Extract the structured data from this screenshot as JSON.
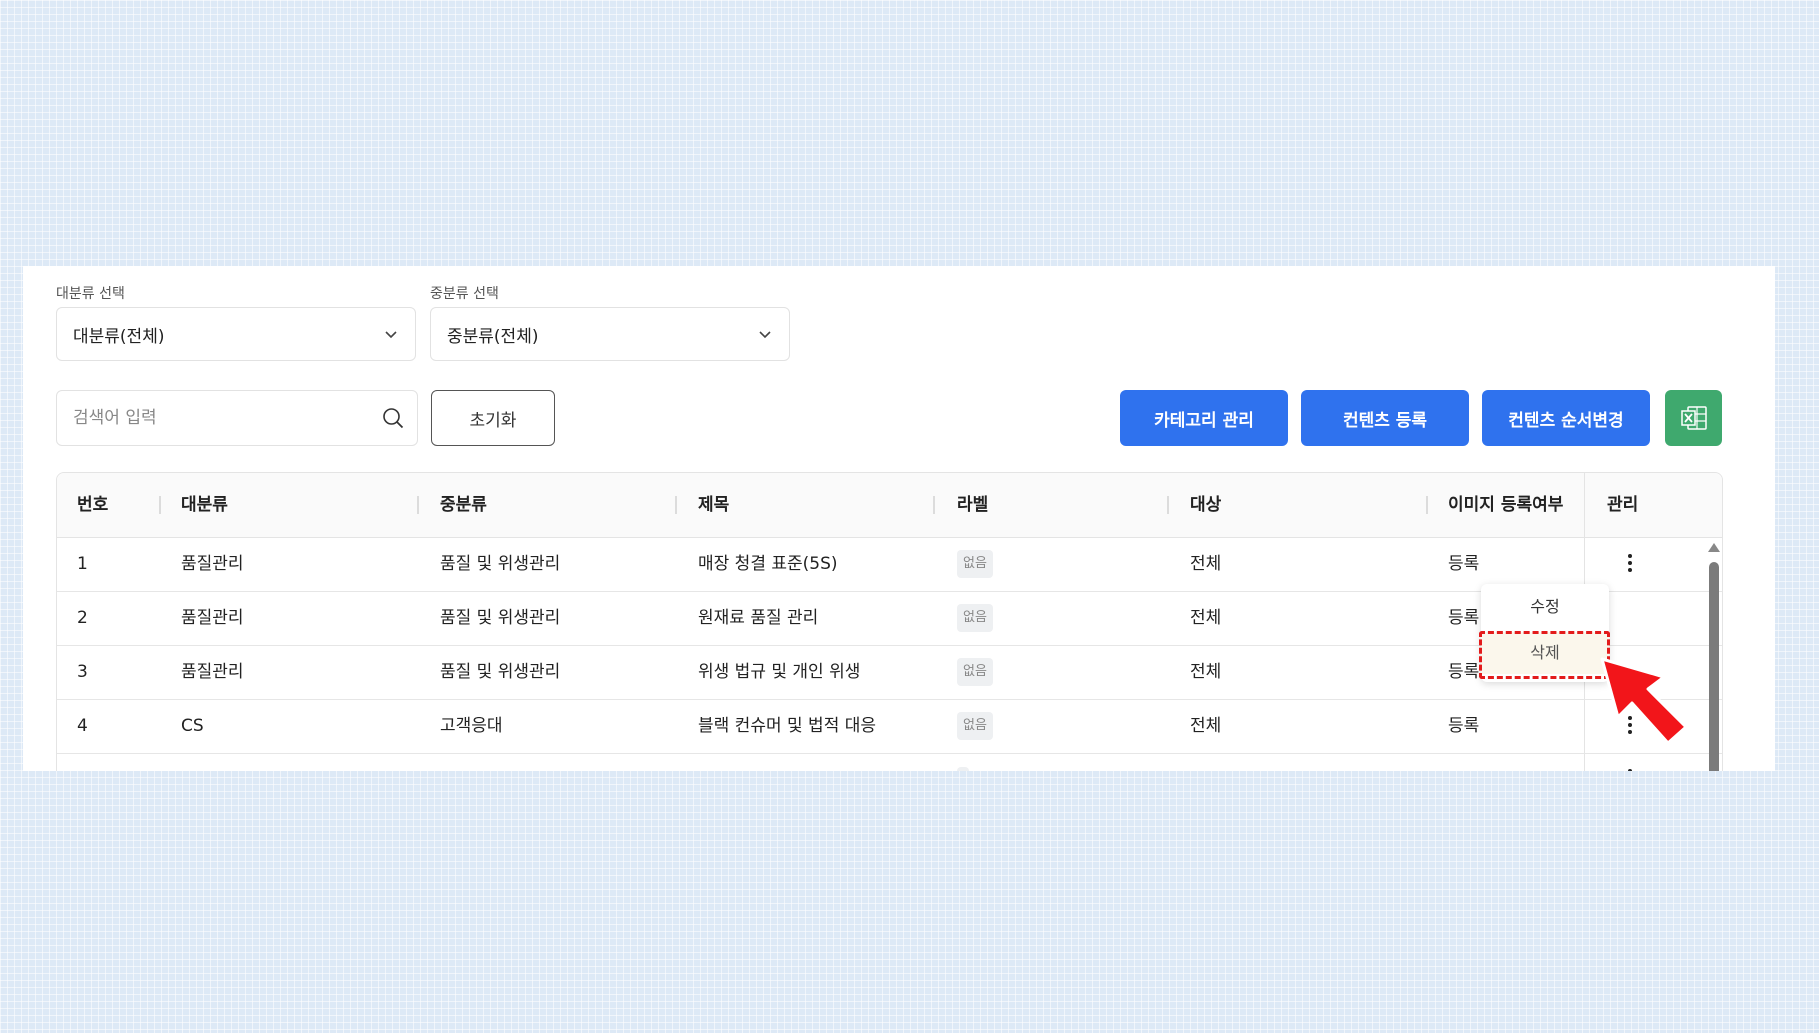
{
  "filters": {
    "major": {
      "label": "대분류 선택",
      "value": "대분류(전체)"
    },
    "middle": {
      "label": "중분류 선택",
      "value": "중분류(전체)"
    }
  },
  "search": {
    "placeholder": "검색어 입력"
  },
  "buttons": {
    "reset": "초기화",
    "category": "카테고리 관리",
    "register": "컨텐츠 등록",
    "reorder": "컨텐츠 순서변경",
    "excel_icon": "excel-icon"
  },
  "table": {
    "headers": [
      "번호",
      "대분류",
      "중분류",
      "제목",
      "라벨",
      "대상",
      "이미지 등록여부",
      "관리"
    ],
    "rows": [
      {
        "no": "1",
        "major": "품질관리",
        "middle": "품질 및 위생관리",
        "title": "매장 청결 표준(5S)",
        "label": "없음",
        "target": "전체",
        "image": "등록"
      },
      {
        "no": "2",
        "major": "품질관리",
        "middle": "품질 및 위생관리",
        "title": "원재료 품질 관리",
        "label": "없음",
        "target": "전체",
        "image": "등록"
      },
      {
        "no": "3",
        "major": "품질관리",
        "middle": "품질 및 위생관리",
        "title": "위생 법규 및 개인 위생",
        "label": "없음",
        "target": "전체",
        "image": "등록"
      },
      {
        "no": "4",
        "major": "CS",
        "middle": "고객응대",
        "title": "블랙 컨슈머 및 법적 대응",
        "label": "없음",
        "target": "전체",
        "image": "등록"
      }
    ]
  },
  "context_menu": {
    "edit": "수정",
    "delete": "삭제"
  },
  "colors": {
    "primary": "#2f72ee",
    "excel": "#3fa96e",
    "highlight": "#e31b1b"
  }
}
